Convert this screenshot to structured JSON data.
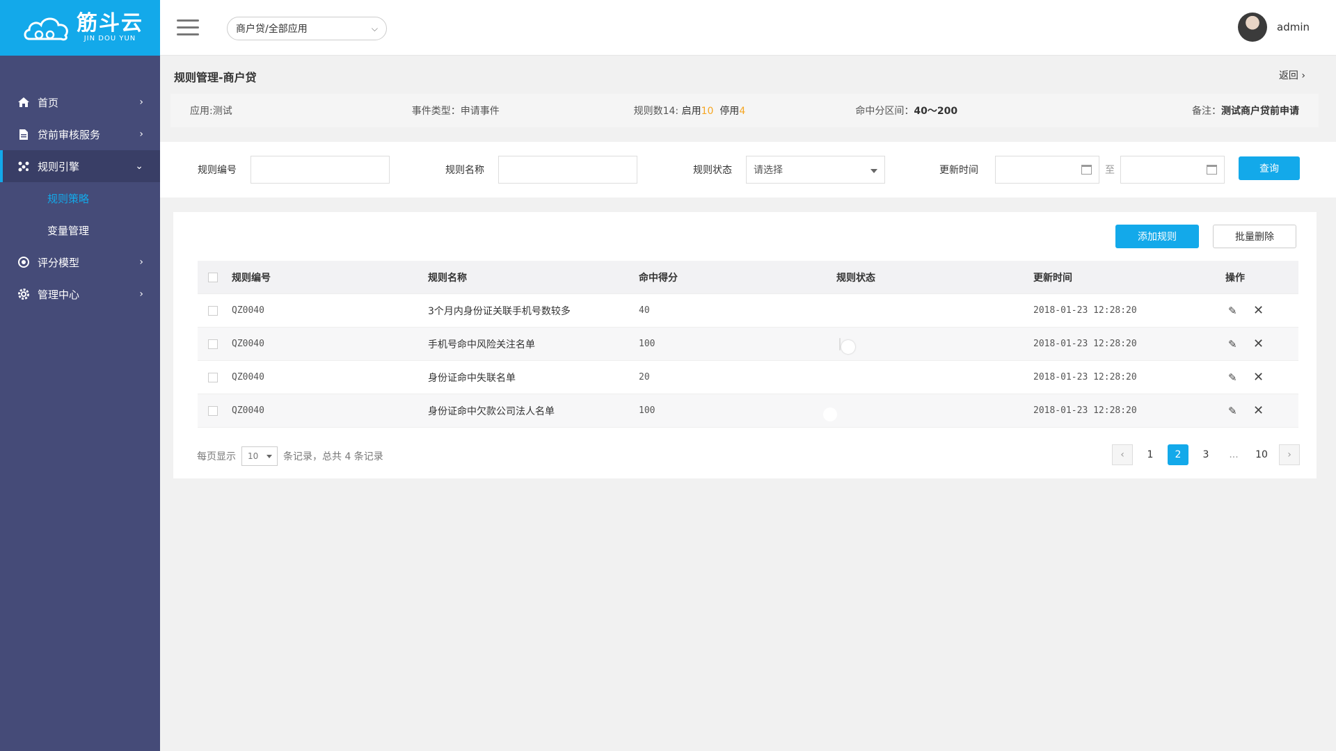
{
  "brand": {
    "name_cn": "筋斗云",
    "name_en": "JIN DOU YUN"
  },
  "colors": {
    "accent": "#13a9ea",
    "sidebar": "#454b78",
    "highlight": "#f5a623"
  },
  "sidebar": {
    "items": [
      {
        "label": "首页",
        "icon": "home-icon"
      },
      {
        "label": "贷前审核服务",
        "icon": "document-icon"
      },
      {
        "label": "规则引擎",
        "icon": "network-icon",
        "expanded": true,
        "children": [
          {
            "label": "规则策略",
            "current": true
          },
          {
            "label": "变量管理"
          }
        ]
      },
      {
        "label": "评分模型",
        "icon": "target-icon"
      },
      {
        "label": "管理中心",
        "icon": "gear-icon"
      }
    ]
  },
  "header": {
    "app_select": "商户贷/全部应用",
    "username": "admin"
  },
  "page": {
    "title": "规则管理-商户贷",
    "back": "返回",
    "info": {
      "app": "应用:测试",
      "event": "事件类型：申请事件",
      "rule_count_prefix": "规则数14:",
      "enabled_label": "启用",
      "enabled_count": "10",
      "disabled_label": "停用",
      "disabled_count": "4",
      "range_label": "命中分区间：",
      "range_value": "40～200",
      "note_label": "备注：",
      "note_value": "测试商户贷前申请"
    }
  },
  "filters": {
    "rule_id_label": "规则编号",
    "rule_name_label": "规则名称",
    "status_label": "规则状态",
    "status_placeholder": "请选择",
    "update_time_label": "更新时间",
    "to": "至",
    "query": "查询"
  },
  "toolbar": {
    "add": "添加规则",
    "batch_delete": "批量删除"
  },
  "table": {
    "columns": [
      "规则编号",
      "规则名称",
      "命中得分",
      "规则状态",
      "更新时间",
      "操作"
    ],
    "rows": [
      {
        "id": "QZ0040",
        "name": "3个月内身份证关联手机号数较多",
        "score": "40",
        "enabled": true,
        "time": "2018-01-23 12:28:20"
      },
      {
        "id": "QZ0040",
        "name": "手机号命中风险关注名单",
        "score": "100",
        "enabled": false,
        "time": "2018-01-23 12:28:20"
      },
      {
        "id": "QZ0040",
        "name": "身份证命中失联名单",
        "score": "20",
        "enabled": true,
        "time": "2018-01-23 12:28:20"
      },
      {
        "id": "QZ0040",
        "name": "身份证命中欠款公司法人名单",
        "score": "100",
        "enabled": true,
        "time": "2018-01-23 12:28:20"
      }
    ]
  },
  "pagination": {
    "per_page_label": "每页显示",
    "page_size": "10",
    "summary": "条记录，总共 4 条记录",
    "pages": [
      "1",
      "2",
      "3",
      "...",
      "10"
    ],
    "current": "2",
    "prev": "‹",
    "next": "›"
  }
}
